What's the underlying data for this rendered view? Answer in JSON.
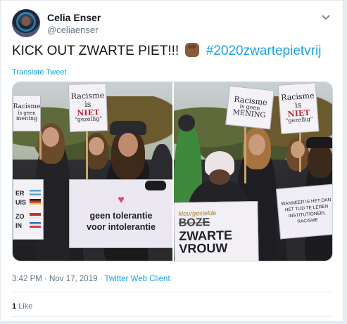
{
  "author": {
    "display_name": "Celia Enser",
    "handle": "@celiaenser"
  },
  "tweet": {
    "text_before": "KICK OUT ZWARTE PIET!!!",
    "emoji_icon": "raised-fist-medium-dark-skin-tone",
    "hashtag": "#2020zwartepietvrij",
    "translate_label": "Translate Tweet"
  },
  "media": {
    "left_photo": {
      "small_sign_line1": "Racisme",
      "small_sign_line2": "is geen",
      "small_sign_line3": "mening",
      "tall_sign_line1": "Racisme",
      "tall_sign_line2": "is",
      "tall_sign_red": "NIET",
      "tall_sign_line3": "\"gezellig\"",
      "big_sign_line1": "geen tolerantie",
      "big_sign_line2": "voor intolerantie",
      "edge_sign_line1": "ER",
      "edge_sign_line2": "UIS",
      "edge_sign_line3": "ZO",
      "edge_sign_line4": "IN"
    },
    "right_photo": {
      "sign_a_line1": "Racisme",
      "sign_a_line2": "is geen",
      "sign_a_line3": "MENING",
      "sign_b_line1": "Racisme",
      "sign_b_line2": "is",
      "sign_b_red": "NIET",
      "sign_b_line3": "\"gezellig\"",
      "big_sign_top": "kleurgestelde",
      "big_sign_struck": "BOZE",
      "big_sign_line1": "ZWARTE",
      "big_sign_line2": "VROUW",
      "hand_sign_line1": "WANNEER IS HET DAN",
      "hand_sign_line2": "HET TIJD TE LEREN",
      "hand_sign_line3": "INSTITUTIONEEL",
      "hand_sign_line4": "RACISME"
    }
  },
  "meta": {
    "time": "3:42 PM",
    "separator": "·",
    "date": "Nov 17, 2019",
    "source": "Twitter Web Client"
  },
  "engagement": {
    "like_count": "1",
    "like_label": "Like"
  },
  "colors": {
    "link": "#1da1f2",
    "secondary_text": "#657786",
    "primary_text": "#14171a"
  }
}
